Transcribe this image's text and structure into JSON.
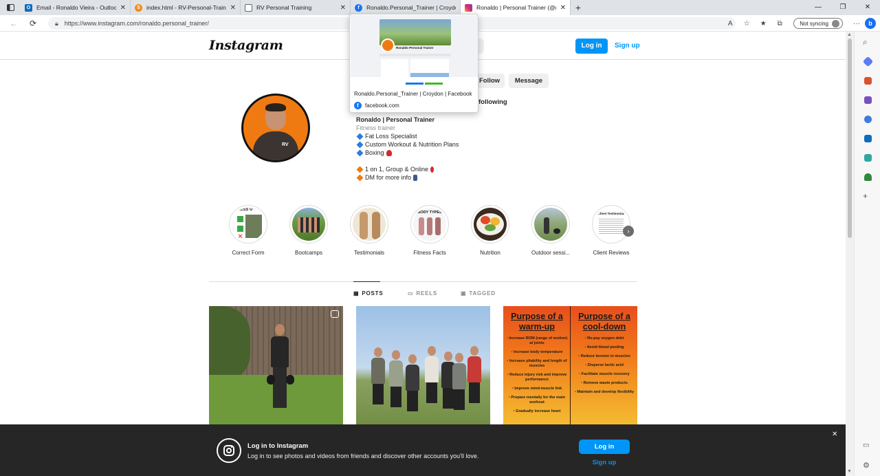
{
  "browser": {
    "tabs": [
      {
        "title": "Email - Ronaldo Vieira - Outlook",
        "icon": "outlook-icon",
        "color": "#0f6cbd"
      },
      {
        "title": "index.html - RV-Personal-Trainer",
        "icon": "sublime-icon",
        "color": "#f08c1c"
      },
      {
        "title": "RV Personal Training",
        "icon": "page-icon",
        "color": "#888888"
      },
      {
        "title": "Ronaldo.Personal_Trainer | Croydon",
        "icon": "facebook-icon",
        "color": "#1877f2"
      },
      {
        "title": "Ronaldo | Personal Trainer (@ron",
        "icon": "instagram-icon",
        "color": "#d62976"
      }
    ],
    "url": "https://www.instagram.com/ronaldo.personal_trainer/",
    "sync_label": "Not syncing"
  },
  "tab_preview": {
    "cover_name": "Ronaldo Personal Trainer",
    "title": "Ronaldo.Personal_Trainer | Croydon | Facebook",
    "domain": "facebook.com"
  },
  "header": {
    "logo": "Instagram",
    "login": "Log in",
    "signup": "Sign up"
  },
  "profile": {
    "follow": "Follow",
    "message": "Message",
    "following": "following",
    "name": "Ronaldo | Personal Trainer",
    "category": "Fitness trainer",
    "bio_lines": [
      "Fat Loss Specialist",
      "Custom Workout & Nutrition Plans",
      "Boxing"
    ],
    "bio_lines2": [
      "1 on 1, Group & Online",
      "DM for more info"
    ]
  },
  "highlights": [
    {
      "label": "Correct Form",
      "caption": "NESS U"
    },
    {
      "label": "Bootcamps"
    },
    {
      "label": "Testimonials"
    },
    {
      "label": "Fitness Facts",
      "caption": "BODY TYPES"
    },
    {
      "label": "Nutrition"
    },
    {
      "label": "Outdoor sessi..."
    },
    {
      "label": "Client Reviews",
      "caption": "Client Testimonial"
    }
  ],
  "post_tabs": {
    "posts": "POSTS",
    "reels": "REELS",
    "tagged": "TAGGED"
  },
  "post3": {
    "left_title": "Purpose of a warm-up",
    "left_items": [
      "Increase ROM (range of motion) at joints",
      "Increase body temperature",
      "Increase pliability and length of muscles",
      "Reduce injury risk and improve performance",
      "Improve mind-muscle link",
      "Prepare mentally for the main workout",
      "Gradually increase heart"
    ],
    "right_title": "Purpose of a cool-down",
    "right_items": [
      "Re-pay oxygen debt",
      "Avoid blood pooling",
      "Reduce tension in muscles",
      "Disperse lactic acid",
      "Facilitate muscle recovery",
      "Remove waste products",
      "Maintain and develop flexibility"
    ]
  },
  "banner": {
    "title": "Log in to Instagram",
    "text": "Log in to see photos and videos from friends and discover other accounts you'll love.",
    "login": "Log in",
    "signup": "Sign up"
  }
}
